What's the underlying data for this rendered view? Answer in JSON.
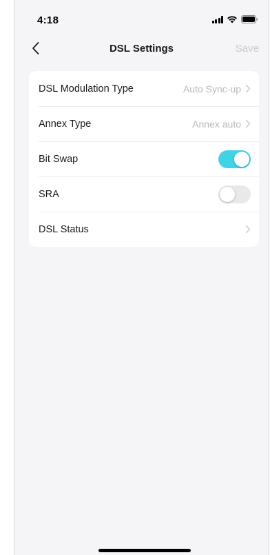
{
  "status_bar": {
    "time": "4:18",
    "icons": [
      "signal-icon",
      "wifi-icon",
      "battery-icon"
    ]
  },
  "nav": {
    "back_icon": "chevron-left-icon",
    "title": "DSL Settings",
    "save_label": "Save"
  },
  "settings": {
    "items": [
      {
        "label": "DSL Modulation Type",
        "value": "Auto Sync-up",
        "type": "link"
      },
      {
        "label": "Annex Type",
        "value": "Annex auto",
        "type": "link"
      },
      {
        "label": "Bit Swap",
        "type": "toggle",
        "on": true
      },
      {
        "label": "SRA",
        "type": "toggle",
        "on": false
      },
      {
        "label": "DSL Status",
        "type": "link"
      }
    ]
  },
  "colors": {
    "accent": "#40d3e6",
    "background": "#f5f5f7",
    "card": "#ffffff",
    "secondary_text": "#b8b8bc"
  }
}
